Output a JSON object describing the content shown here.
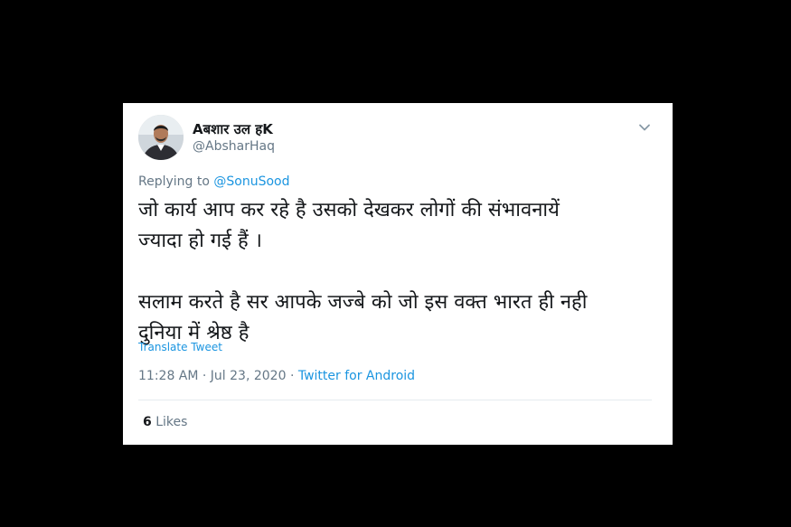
{
  "tweet": {
    "display_name": "Aबशार उल हK",
    "handle": "@AbsharHaq",
    "replying_prefix": "Replying to",
    "replying_to": "@SonuSood",
    "text": "जो कार्य आप कर रहे है उसको देखकर लोगों की संभावनायें\nज्यादा हो गई हैं ।\n\nसलाम करते है सर आपके जज्बे को जो इस वक्त भारत ही नही\nदुनिया में श्रेष्ठ है",
    "translate_label": "Translate Tweet",
    "timestamp": "11:28 AM · Jul 23, 2020",
    "separator": " · ",
    "source": "Twitter for Android",
    "likes_count": "6",
    "likes_label": "Likes"
  },
  "icons": {
    "caret": "chevron-down-icon",
    "avatar": "avatar"
  },
  "colors": {
    "background": "#000000",
    "card": "#ffffff",
    "link": "#1b95e0",
    "muted": "#657786",
    "text": "#14171a"
  }
}
